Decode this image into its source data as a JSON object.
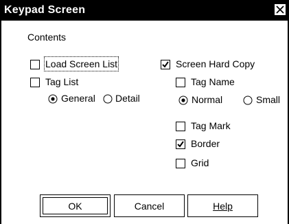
{
  "window": {
    "title": "Keypad Screen"
  },
  "contents_label": "Contents",
  "left_options": {
    "load_screen_list": {
      "label": "Load Screen List",
      "checked": false
    },
    "tag_list": {
      "label": "Tag List",
      "checked": false
    },
    "tag_list_mode": {
      "general": "General",
      "detail": "Detail",
      "selected": "General"
    }
  },
  "right_options": {
    "screen_hard_copy": {
      "label": "Screen Hard Copy",
      "checked": true
    },
    "tag_name": {
      "label": "Tag Name",
      "checked": false
    },
    "tag_name_size": {
      "normal": "Normal",
      "small": "Small",
      "selected": "Normal"
    },
    "tag_mark": {
      "label": "Tag Mark",
      "checked": false
    },
    "border": {
      "label": "Border",
      "checked": true
    },
    "grid": {
      "label": "Grid",
      "checked": false
    }
  },
  "buttons": {
    "ok": "OK",
    "cancel": "Cancel",
    "help": "Help"
  }
}
